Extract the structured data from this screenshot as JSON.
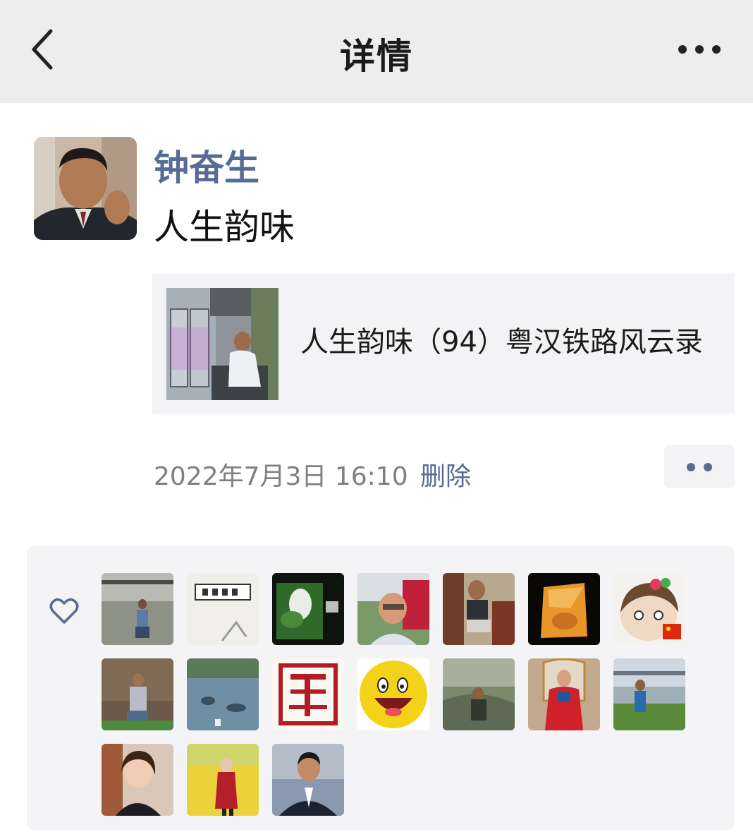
{
  "header": {
    "title": "详情"
  },
  "post": {
    "username": "钟奋生",
    "text": "人生韵味",
    "link": {
      "title": "人生韵味（94）粤汉铁路风云录"
    },
    "timestamp": "2022年7月3日 16:10",
    "delete_label": "删除"
  },
  "likes": {
    "avatars": [
      {
        "name": "liker-avatar-1"
      },
      {
        "name": "liker-avatar-2"
      },
      {
        "name": "liker-avatar-3"
      },
      {
        "name": "liker-avatar-4"
      },
      {
        "name": "liker-avatar-5"
      },
      {
        "name": "liker-avatar-6"
      },
      {
        "name": "liker-avatar-7"
      },
      {
        "name": "liker-avatar-8"
      },
      {
        "name": "liker-avatar-9"
      },
      {
        "name": "liker-avatar-10"
      },
      {
        "name": "liker-avatar-11"
      },
      {
        "name": "liker-avatar-12"
      },
      {
        "name": "liker-avatar-13"
      },
      {
        "name": "liker-avatar-14"
      },
      {
        "name": "liker-avatar-15"
      },
      {
        "name": "liker-avatar-16"
      },
      {
        "name": "liker-avatar-17"
      }
    ]
  },
  "colors": {
    "link_blue": "#576b95",
    "header_bg": "#ededed",
    "card_bg": "#f3f3f5"
  },
  "icons": {
    "back": "chevron-left-icon",
    "more": "more-dots-icon",
    "like": "heart-outline-icon"
  }
}
